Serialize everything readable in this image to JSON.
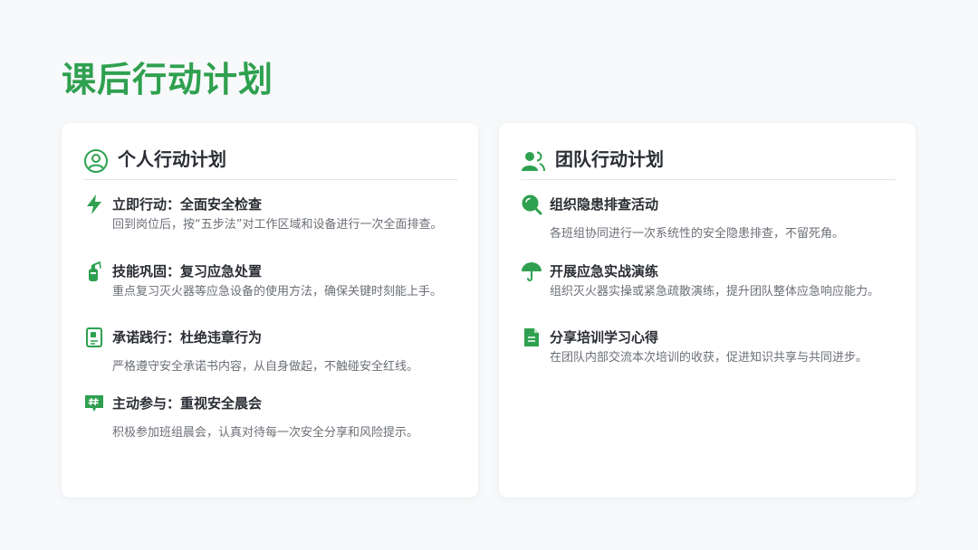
{
  "page": {
    "title": "课后行动计划"
  },
  "colors": {
    "accent": "#2fa04f",
    "background": "#f7f9fb",
    "card": "#ffffff"
  },
  "personal": {
    "heading": "个人行动计划",
    "icon": "user-circle-icon",
    "items": [
      {
        "icon": "lightning-icon",
        "title": "立即行动：全面安全检查",
        "desc": "回到岗位后，按“五步法”对工作区域和设备进行一次全面排查。"
      },
      {
        "icon": "fire-extinguisher-icon",
        "title": "技能巩固：复习应急处置",
        "desc": "重点复习灭火器等应急设备的使用方法，确保关键时刻能上手。"
      },
      {
        "icon": "notebook-icon",
        "title": "承诺践行：杜绝违章行为",
        "desc": "严格遵守安全承诺书内容，从自身做起，不触碰安全红线。"
      },
      {
        "icon": "hashtag-chat-icon",
        "title": "主动参与：重视安全晨会",
        "desc": "积极参加班组晨会，认真对待每一次安全分享和风险提示。"
      }
    ]
  },
  "team": {
    "heading": "团队行动计划",
    "icon": "users-icon",
    "items": [
      {
        "icon": "search-icon",
        "title": "组织隐患排查活动",
        "desc": "各班组协同进行一次系统性的安全隐患排查，不留死角。"
      },
      {
        "icon": "umbrella-icon",
        "title": "开展应急实战演练",
        "desc": "组织灭火器实操或紧急疏散演练，提升团队整体应急响应能力。"
      },
      {
        "icon": "document-icon",
        "title": "分享培训学习心得",
        "desc": "在团队内部交流本次培训的收获，促进知识共享与共同进步。"
      }
    ]
  }
}
